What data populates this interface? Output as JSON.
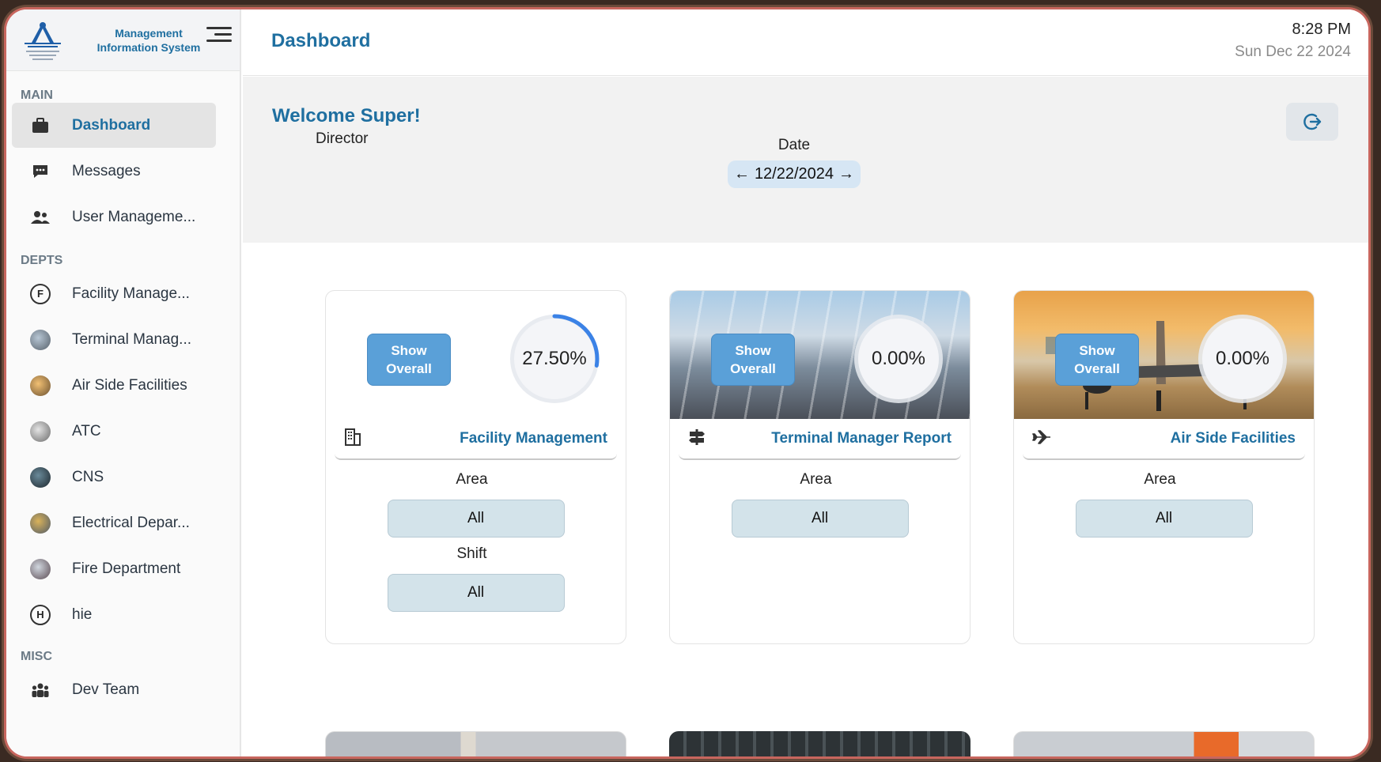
{
  "brand": {
    "line1": "Management",
    "line2": "Information System"
  },
  "sidebar": {
    "sections": [
      {
        "label": "MAIN"
      },
      {
        "label": "DEPTS"
      },
      {
        "label": "MISC"
      }
    ],
    "main_items": [
      {
        "label": "Dashboard",
        "icon": "briefcase-icon",
        "active": true
      },
      {
        "label": "Messages",
        "icon": "chat-icon"
      },
      {
        "label": "User Manageme...",
        "icon": "users-icon"
      }
    ],
    "dept_items": [
      {
        "label": "Facility Manage...",
        "icon": "letter-f-icon",
        "letter": "F"
      },
      {
        "label": "Terminal Manag...",
        "icon": "terminal-avatar-icon"
      },
      {
        "label": "Air Side Facilities",
        "icon": "airside-avatar-icon"
      },
      {
        "label": "ATC",
        "icon": "atc-avatar-icon"
      },
      {
        "label": "CNS",
        "icon": "cns-avatar-icon"
      },
      {
        "label": "Electrical Depar...",
        "icon": "electrical-avatar-icon"
      },
      {
        "label": "Fire Department",
        "icon": "fire-avatar-icon"
      },
      {
        "label": "hie",
        "icon": "letter-h-icon",
        "letter": "H"
      }
    ],
    "misc_items": [
      {
        "label": "Dev Team",
        "icon": "team-icon"
      }
    ]
  },
  "header": {
    "title": "Dashboard",
    "time": "8:28 PM",
    "date": "Sun Dec 22 2024"
  },
  "welcome": {
    "greeting": "Welcome Super!",
    "role": "Director"
  },
  "date_picker": {
    "label": "Date",
    "prev": "←",
    "value": "12/22/2024",
    "next": "→"
  },
  "cards": [
    {
      "title": "Facility Management",
      "icon": "building-icon",
      "percent": "27.50%",
      "progress": 0.275,
      "show_label": "Show Overall",
      "fields": [
        {
          "label": "Area",
          "value": "All"
        },
        {
          "label": "Shift",
          "value": "All"
        }
      ]
    },
    {
      "title": "Terminal Manager Report",
      "icon": "signpost-icon",
      "percent": "0.00%",
      "progress": 0,
      "show_label": "Show Overall",
      "fields": [
        {
          "label": "Area",
          "value": "All"
        }
      ]
    },
    {
      "title": "Air Side Facilities",
      "icon": "airplane-icon",
      "percent": "0.00%",
      "progress": 0,
      "show_label": "Show Overall",
      "fields": [
        {
          "label": "Area",
          "value": "All"
        }
      ]
    }
  ],
  "colors": {
    "accent": "#1f6fa0",
    "button": "#5aa0d8",
    "progress": "#3b82e6"
  }
}
